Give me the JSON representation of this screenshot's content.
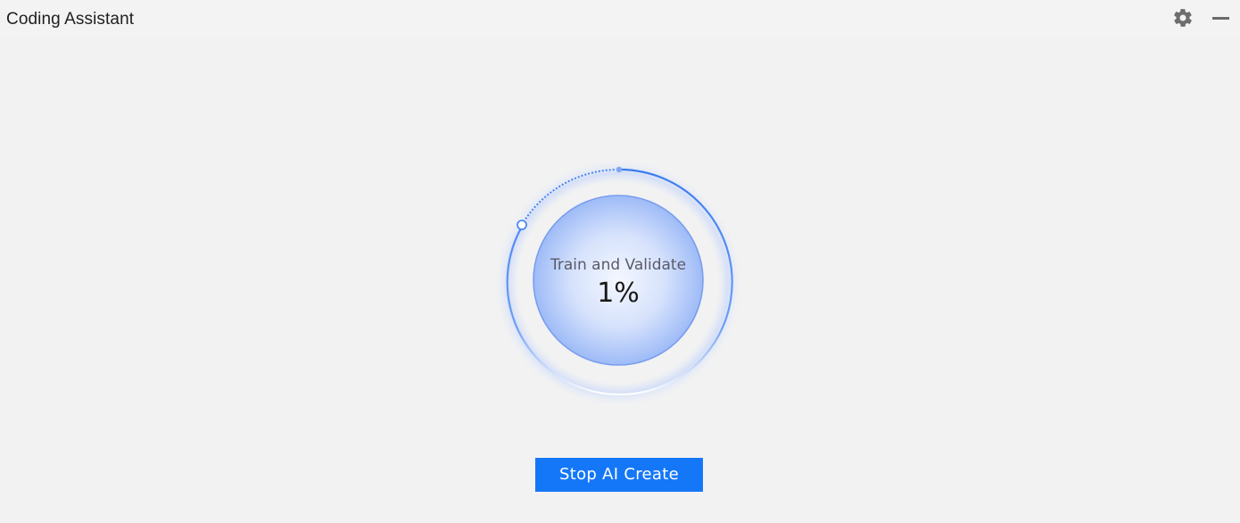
{
  "window": {
    "title": "Coding Assistant"
  },
  "titlebar": {
    "settings_icon": "gear-icon",
    "minimize_icon": "minimize-icon"
  },
  "progress": {
    "stage_label": "Train and Validate",
    "percent_text": "1%",
    "percent_value": 0.01
  },
  "actions": {
    "stop_label": "Stop AI Create"
  },
  "colors": {
    "accent": "#1477f8",
    "ring": "#3d7ff0",
    "inner_fill": "#9fbdf8",
    "background": "#f2f2f2"
  }
}
